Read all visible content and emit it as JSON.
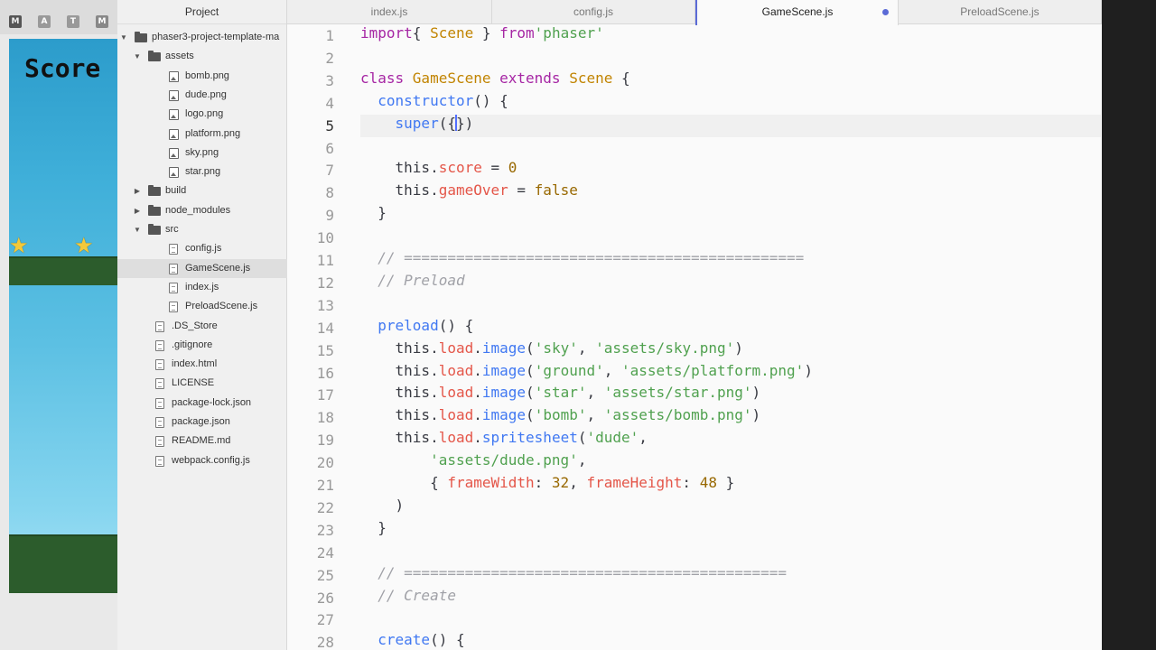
{
  "bg_browser": {
    "toolbar_icons": [
      "M",
      "A",
      "T",
      "M"
    ],
    "game_score_label": "Score",
    "sky_color": "#3fafd9",
    "ground_color": "#2c5c2c"
  },
  "tree": {
    "header": "Project",
    "rows": [
      {
        "type": "folder",
        "open": true,
        "depth": 0,
        "label": "phaser3-project-template-ma"
      },
      {
        "type": "folder",
        "open": true,
        "depth": 1,
        "label": "assets"
      },
      {
        "type": "image",
        "depth": 2,
        "label": "bomb.png"
      },
      {
        "type": "image",
        "depth": 2,
        "label": "dude.png"
      },
      {
        "type": "image",
        "depth": 2,
        "label": "logo.png"
      },
      {
        "type": "image",
        "depth": 2,
        "label": "platform.png"
      },
      {
        "type": "image",
        "depth": 2,
        "label": "sky.png"
      },
      {
        "type": "image",
        "depth": 2,
        "label": "star.png"
      },
      {
        "type": "folder",
        "open": false,
        "depth": 1,
        "label": "build"
      },
      {
        "type": "folder",
        "open": false,
        "depth": 1,
        "label": "node_modules"
      },
      {
        "type": "folder",
        "open": true,
        "depth": 1,
        "label": "src"
      },
      {
        "type": "file",
        "depth": 2,
        "label": "config.js"
      },
      {
        "type": "file",
        "depth": 2,
        "label": "GameScene.js",
        "selected": true
      },
      {
        "type": "file",
        "depth": 2,
        "label": "index.js"
      },
      {
        "type": "file",
        "depth": 2,
        "label": "PreloadScene.js"
      },
      {
        "type": "file",
        "depth": 1,
        "label": ".DS_Store"
      },
      {
        "type": "file",
        "depth": 1,
        "label": ".gitignore"
      },
      {
        "type": "file",
        "depth": 1,
        "label": "index.html"
      },
      {
        "type": "file",
        "depth": 1,
        "label": "LICENSE"
      },
      {
        "type": "file",
        "depth": 1,
        "label": "package-lock.json"
      },
      {
        "type": "file",
        "depth": 1,
        "label": "package.json"
      },
      {
        "type": "file",
        "depth": 1,
        "label": "README.md"
      },
      {
        "type": "file",
        "depth": 1,
        "label": "webpack.config.js"
      }
    ]
  },
  "tabs": [
    {
      "label": "index.js",
      "active": false
    },
    {
      "label": "config.js",
      "active": false
    },
    {
      "label": "GameScene.js",
      "active": true,
      "modified": true
    },
    {
      "label": "PreloadScene.js",
      "active": false
    }
  ],
  "editor": {
    "current_line": 5,
    "colors": {
      "keyword": "#a626a4",
      "class": "#c18401",
      "string": "#50a14f",
      "function": "#4078f2",
      "property": "#e45649",
      "number": "#986801",
      "comment": "#a0a1a7"
    },
    "lines": [
      [
        [
          "kw",
          "import"
        ],
        [
          "",
          "{ "
        ],
        [
          "cls",
          "Scene"
        ],
        [
          "",
          " } "
        ],
        [
          "kw",
          "from"
        ],
        [
          "",
          "",
          " "
        ],
        [
          "str",
          "'phaser'"
        ]
      ],
      [],
      [
        [
          "kw",
          "class "
        ],
        [
          "cls",
          "GameScene"
        ],
        [
          "kw",
          " extends "
        ],
        [
          "cls",
          "Scene"
        ],
        [
          "",
          " {"
        ]
      ],
      [
        [
          "",
          "  "
        ],
        [
          "fn",
          "constructor"
        ],
        [
          "",
          "() {"
        ]
      ],
      [
        [
          "",
          "    "
        ],
        [
          "fn",
          "super"
        ],
        [
          "",
          "("
        ],
        [
          "cursor",
          "{}"
        ],
        [
          "",
          ")"
        ]
      ],
      [],
      [
        [
          "",
          "    this."
        ],
        [
          "prop",
          "score"
        ],
        [
          "",
          " = "
        ],
        [
          "num",
          "0"
        ]
      ],
      [
        [
          "",
          "    this."
        ],
        [
          "prop",
          "gameOver"
        ],
        [
          "",
          " = "
        ],
        [
          "num",
          "false"
        ]
      ],
      [
        [
          "",
          "  }"
        ]
      ],
      [],
      [
        [
          "cm",
          "  // =============================================="
        ]
      ],
      [
        [
          "cm",
          "  // Preload"
        ]
      ],
      [],
      [
        [
          "",
          "  "
        ],
        [
          "fn",
          "preload"
        ],
        [
          "",
          "() {"
        ]
      ],
      [
        [
          "",
          "    this."
        ],
        [
          "prop",
          "load"
        ],
        [
          "",
          "."
        ],
        [
          "fn",
          "image"
        ],
        [
          "",
          "("
        ],
        [
          "str",
          "'sky'"
        ],
        [
          "",
          ", "
        ],
        [
          "str",
          "'assets/sky.png'"
        ],
        [
          "",
          ")"
        ]
      ],
      [
        [
          "",
          "    this."
        ],
        [
          "prop",
          "load"
        ],
        [
          "",
          "."
        ],
        [
          "fn",
          "image"
        ],
        [
          "",
          "("
        ],
        [
          "str",
          "'ground'"
        ],
        [
          "",
          ", "
        ],
        [
          "str",
          "'assets/platform.png'"
        ],
        [
          "",
          ")"
        ]
      ],
      [
        [
          "",
          "    this."
        ],
        [
          "prop",
          "load"
        ],
        [
          "",
          "."
        ],
        [
          "fn",
          "image"
        ],
        [
          "",
          "("
        ],
        [
          "str",
          "'star'"
        ],
        [
          "",
          ", "
        ],
        [
          "str",
          "'assets/star.png'"
        ],
        [
          "",
          ")"
        ]
      ],
      [
        [
          "",
          "    this."
        ],
        [
          "prop",
          "load"
        ],
        [
          "",
          "."
        ],
        [
          "fn",
          "image"
        ],
        [
          "",
          "("
        ],
        [
          "str",
          "'bomb'"
        ],
        [
          "",
          ", "
        ],
        [
          "str",
          "'assets/bomb.png'"
        ],
        [
          "",
          ")"
        ]
      ],
      [
        [
          "",
          "    this."
        ],
        [
          "prop",
          "load"
        ],
        [
          "",
          "."
        ],
        [
          "fn",
          "spritesheet"
        ],
        [
          "",
          "("
        ],
        [
          "str",
          "'dude'"
        ],
        [
          "",
          ","
        ]
      ],
      [
        [
          "",
          "        "
        ],
        [
          "str",
          "'assets/dude.png'"
        ],
        [
          "",
          ","
        ]
      ],
      [
        [
          "",
          "        { "
        ],
        [
          "prop",
          "frameWidth"
        ],
        [
          "",
          ": "
        ],
        [
          "num",
          "32"
        ],
        [
          "",
          ", "
        ],
        [
          "prop",
          "frameHeight"
        ],
        [
          "",
          ": "
        ],
        [
          "num",
          "48"
        ],
        [
          "",
          " }"
        ]
      ],
      [
        [
          "",
          "    )"
        ]
      ],
      [
        [
          "",
          "  }"
        ]
      ],
      [],
      [
        [
          "cm",
          "  // ============================================"
        ]
      ],
      [
        [
          "cm",
          "  // Create"
        ]
      ],
      [],
      [
        [
          "",
          "  "
        ],
        [
          "fn",
          "create"
        ],
        [
          "",
          "() {"
        ]
      ]
    ]
  }
}
